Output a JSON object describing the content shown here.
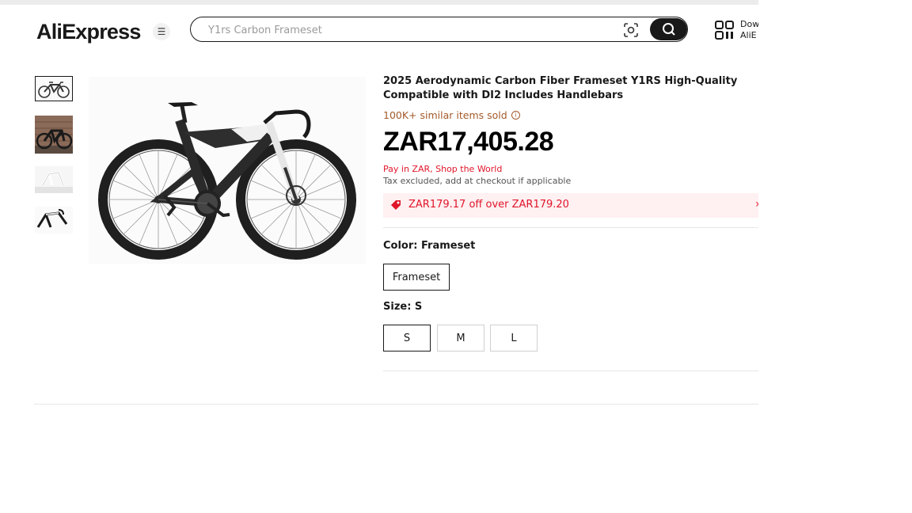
{
  "header": {
    "logo_text": "AliExpress",
    "search_placeholder": "Y1rs Carbon Frameset",
    "download_line1": "Dow",
    "download_line2": "AliE"
  },
  "gallery": {
    "thumbnails": [
      "bike-side-view",
      "bike-on-brick-wall",
      "white-frame",
      "frame-with-handlebar"
    ],
    "selected_index": 0
  },
  "product": {
    "title": "2025 Aerodynamic Carbon Fiber Frameset Y1RS High-Quality Compatible with DI2 Includes Handlebars",
    "sold": "100K+ similar items sold",
    "price": "ZAR17,405.28",
    "pay_note": "Pay in ZAR, Shop the World",
    "tax_note": "Tax excluded, add at checkout if applicable",
    "coupon": "ZAR179.17 off over ZAR179.20",
    "color_label": "Color: Frameset",
    "color_options": [
      "Frameset"
    ],
    "size_label": "Size: S",
    "size_options": [
      "S",
      "M",
      "L"
    ],
    "selected_size": "S"
  },
  "colors": {
    "accent_red": "#e0152a",
    "sold_brown": "#a35a2a",
    "coupon_bg": "#fff0f1",
    "logo_orange": "#f7a300"
  }
}
